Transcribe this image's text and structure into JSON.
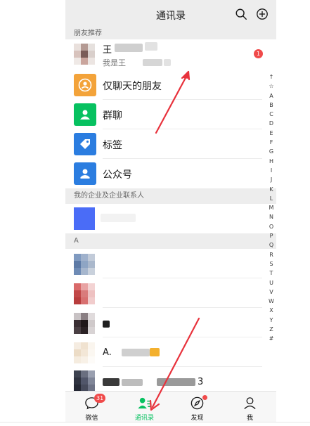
{
  "header": {
    "title": "通讯录"
  },
  "sections": {
    "recommend": "朋友推荐",
    "enterprise": "我的企业及企业联系人",
    "letter_a": "A"
  },
  "recommend_row": {
    "name_visible": "王",
    "subtitle_visible": "我是王",
    "badge": "1"
  },
  "menu": [
    {
      "label": "仅聊天的朋友",
      "icon": "chat-icon",
      "color": "#f3a33a"
    },
    {
      "label": "群聊",
      "icon": "group-icon",
      "color": "#07c160"
    },
    {
      "label": "标签",
      "icon": "tag-icon",
      "color": "#2b7de0"
    },
    {
      "label": "公众号",
      "icon": "official-account-icon",
      "color": "#2b7de0"
    }
  ],
  "contacts": [
    {
      "name_visible": ""
    },
    {
      "name_visible": ""
    },
    {
      "name_visible": ""
    },
    {
      "name_visible": ""
    },
    {
      "name_visible": "A."
    },
    {
      "name_visible": "3"
    }
  ],
  "index_letters": [
    "↑",
    "☆",
    "A",
    "B",
    "C",
    "D",
    "E",
    "F",
    "G",
    "H",
    "I",
    "J",
    "K",
    "L",
    "M",
    "N",
    "O",
    "P",
    "Q",
    "R",
    "S",
    "T",
    "U",
    "V",
    "W",
    "X",
    "Y",
    "Z",
    "#"
  ],
  "tabs": [
    {
      "label": "微信",
      "icon": "chat-bubble-icon",
      "badge": "31",
      "active": false
    },
    {
      "label": "通讯录",
      "icon": "contacts-icon",
      "active": true
    },
    {
      "label": "发现",
      "icon": "compass-icon",
      "active": false
    },
    {
      "label": "我",
      "icon": "person-icon",
      "active": false
    }
  ],
  "colors": {
    "accent": "#07c160",
    "arrow": "#e8323c",
    "badge": "#f04a4a"
  }
}
